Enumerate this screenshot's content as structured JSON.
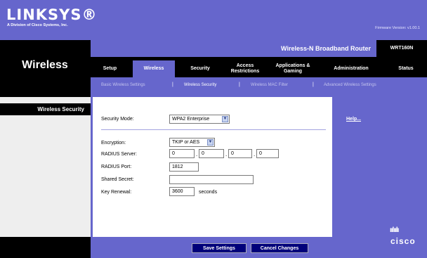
{
  "brand": {
    "name": "LINKSYS®",
    "subtitle": "A Division of Cisco Systems, Inc."
  },
  "firmware": "Firmware Version: v1.00.1",
  "product": {
    "name": "Wireless-N Broadband Router",
    "model": "WRT160N"
  },
  "section_title": "Wireless",
  "tabs": [
    {
      "label": "Setup"
    },
    {
      "label": "Wireless"
    },
    {
      "label": "Security"
    },
    {
      "label": "Access Restrictions"
    },
    {
      "label": "Applications & Gaming"
    },
    {
      "label": "Administration"
    },
    {
      "label": "Status"
    }
  ],
  "active_tab": "Wireless",
  "subtabs": [
    {
      "label": "Basic Wireless Settings"
    },
    {
      "label": "Wireless Security"
    },
    {
      "label": "Wireless MAC Filter"
    },
    {
      "label": "Advanced Wireless Settings"
    }
  ],
  "subtab_separator": "|",
  "current_subtab": "Wireless Security",
  "left_heading": "Wireless Security",
  "form": {
    "security_mode": {
      "label": "Security Mode:",
      "value": "WPA2 Enterprise"
    },
    "encryption": {
      "label": "Encryption:",
      "value": "TKIP or AES"
    },
    "radius_server": {
      "label": "RADIUS Server:",
      "octets": [
        "0",
        "0",
        "0",
        "0"
      ],
      "separator": "."
    },
    "radius_port": {
      "label": "RADIUS Port:",
      "value": "1812"
    },
    "shared_secret": {
      "label": "Shared Secret:",
      "value": ""
    },
    "key_renewal": {
      "label": "Key Renewal:",
      "value": "3600",
      "unit": "seconds"
    }
  },
  "help_link": "Help...",
  "buttons": {
    "save": "Save Settings",
    "cancel": "Cancel Changes"
  },
  "cisco": {
    "logo_text": "cisco",
    "bars": "ıılıılı"
  },
  "colors": {
    "brand_purple": "#6666cc",
    "band_black": "#000000",
    "button_navy": "#00007a"
  },
  "icons": {
    "dropdown": "chevron-down-icon"
  }
}
